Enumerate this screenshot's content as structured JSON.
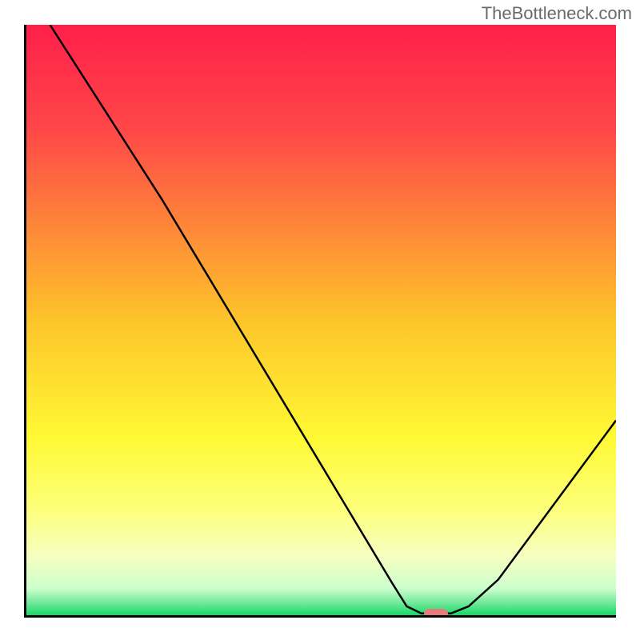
{
  "watermark": "TheBottleneck.com",
  "chart_data": {
    "type": "line",
    "title": "",
    "xlabel": "",
    "ylabel": "",
    "x_range": [
      0,
      100
    ],
    "y_range": [
      0,
      100
    ],
    "gradient_stops": [
      {
        "pos": 0.0,
        "color": "#ff1f4a"
      },
      {
        "pos": 0.18,
        "color": "#ff4848"
      },
      {
        "pos": 0.5,
        "color": "#fdc42a"
      },
      {
        "pos": 0.7,
        "color": "#fff934"
      },
      {
        "pos": 0.82,
        "color": "#fdff7a"
      },
      {
        "pos": 0.9,
        "color": "#f6ffc0"
      },
      {
        "pos": 0.955,
        "color": "#ccffcd"
      },
      {
        "pos": 0.98,
        "color": "#6de897"
      },
      {
        "pos": 1.0,
        "color": "#16d966"
      }
    ],
    "curve_points": [
      {
        "x": 4.0,
        "y": 100.0
      },
      {
        "x": 23.0,
        "y": 70.4
      },
      {
        "x": 62.0,
        "y": 5.5
      },
      {
        "x": 64.5,
        "y": 1.5
      },
      {
        "x": 67.0,
        "y": 0.3
      },
      {
        "x": 72.0,
        "y": 0.3
      },
      {
        "x": 75.0,
        "y": 1.5
      },
      {
        "x": 80.0,
        "y": 6.0
      },
      {
        "x": 100.0,
        "y": 33.0
      }
    ],
    "optimum_marker": {
      "x": 69.5,
      "y": 0.3
    }
  }
}
